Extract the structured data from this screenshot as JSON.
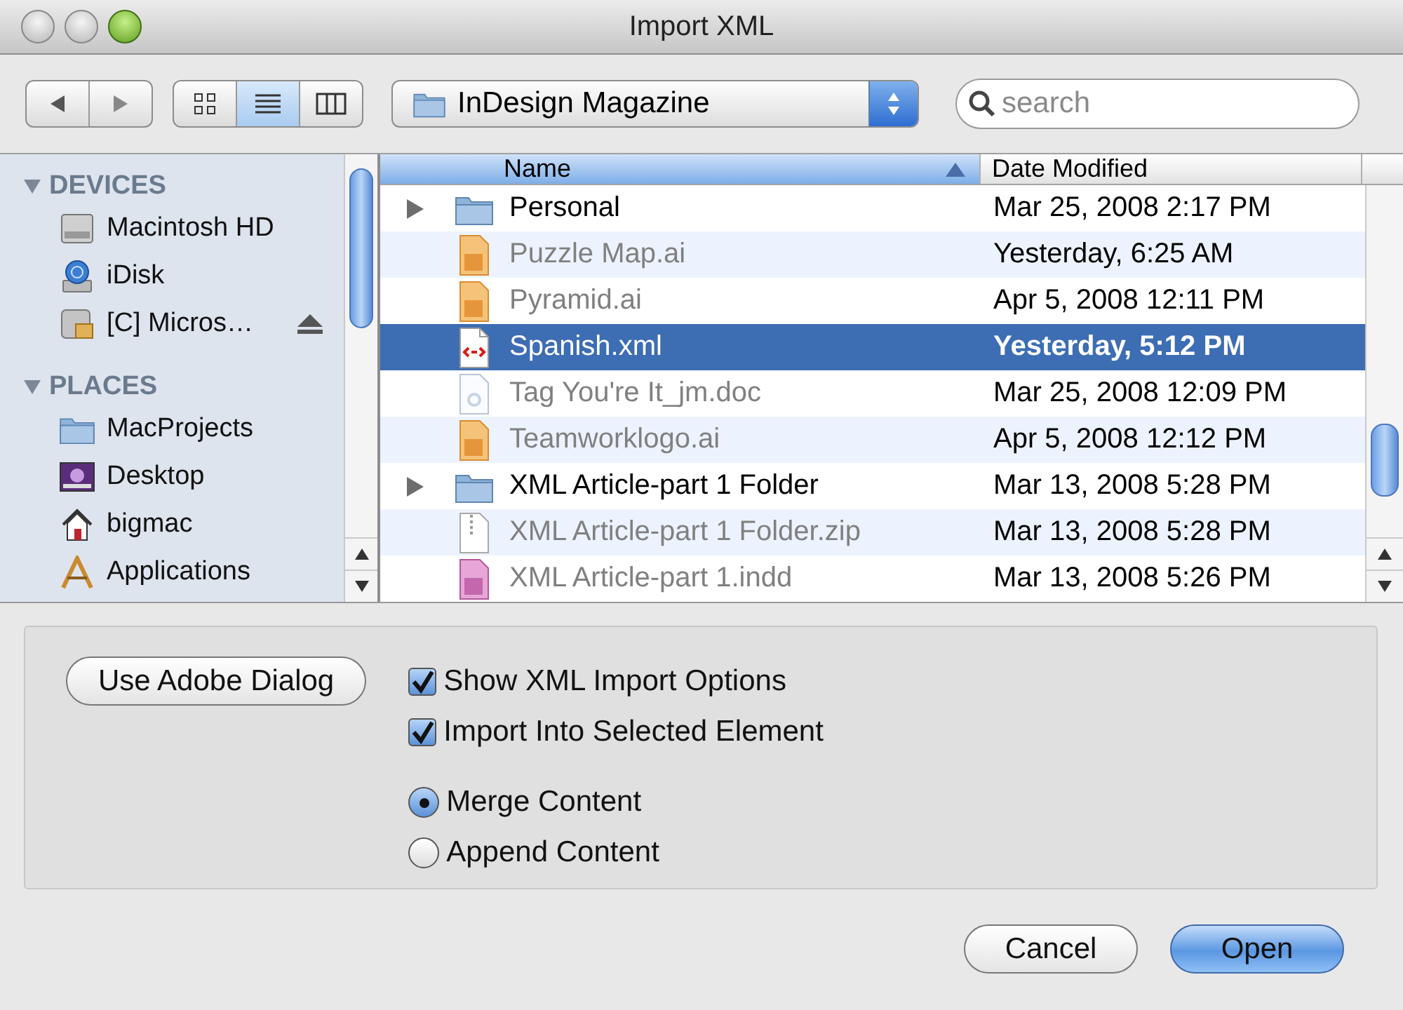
{
  "window": {
    "title": "Import XML"
  },
  "toolbar": {
    "view_modes": [
      {
        "kind": "icon",
        "selected": false
      },
      {
        "kind": "list",
        "selected": true
      },
      {
        "kind": "column",
        "selected": false
      }
    ],
    "location": {
      "value": "InDesign Magazine"
    },
    "search": {
      "placeholder": "search"
    }
  },
  "sidebar": {
    "sections": [
      {
        "title": "DEVICES",
        "expanded": true,
        "items": [
          {
            "label": "Macintosh HD",
            "kind": "drive",
            "ejectable": false
          },
          {
            "label": "iDisk",
            "kind": "idisk",
            "ejectable": false
          },
          {
            "label": "[C] Micros…",
            "kind": "network",
            "ejectable": true
          }
        ]
      },
      {
        "title": "PLACES",
        "expanded": true,
        "items": [
          {
            "label": "MacProjects",
            "kind": "folder",
            "ejectable": false
          },
          {
            "label": "Desktop",
            "kind": "desktop",
            "ejectable": false
          },
          {
            "label": "bigmac",
            "kind": "home",
            "ejectable": false
          },
          {
            "label": "Applications",
            "kind": "apps",
            "ejectable": false
          }
        ]
      }
    ]
  },
  "file_list": {
    "columns": [
      {
        "label": "Name",
        "sorted": true
      },
      {
        "label": "Date Modified",
        "sorted": false
      }
    ],
    "rows": [
      {
        "name": "Personal",
        "date": "Mar 25, 2008 2:17 PM",
        "kind": "folder",
        "disabled": false,
        "selected": false
      },
      {
        "name": "Puzzle Map.ai",
        "date": "Yesterday, 6:25 AM",
        "kind": "ai",
        "disabled": true,
        "selected": false
      },
      {
        "name": "Pyramid.ai",
        "date": "Apr 5, 2008 12:11 PM",
        "kind": "ai",
        "disabled": true,
        "selected": false
      },
      {
        "name": "Spanish.xml",
        "date": "Yesterday, 5:12 PM",
        "kind": "xml",
        "disabled": false,
        "selected": true
      },
      {
        "name": "Tag You're It_jm.doc",
        "date": "Mar 25, 2008 12:09 PM",
        "kind": "doc",
        "disabled": true,
        "selected": false
      },
      {
        "name": "Teamworklogo.ai",
        "date": "Apr 5, 2008 12:12 PM",
        "kind": "ai",
        "disabled": true,
        "selected": false
      },
      {
        "name": "XML Article-part 1 Folder",
        "date": "Mar 13, 2008 5:28 PM",
        "kind": "folder",
        "disabled": false,
        "selected": false
      },
      {
        "name": "XML Article-part 1 Folder.zip",
        "date": "Mar 13, 2008 5:28 PM",
        "kind": "zip",
        "disabled": true,
        "selected": false
      },
      {
        "name": "XML Article-part 1.indd",
        "date": "Mar 13, 2008 5:26 PM",
        "kind": "indd",
        "disabled": true,
        "selected": false
      }
    ]
  },
  "options": {
    "adobe_button": "Use Adobe Dialog",
    "checkboxes": [
      {
        "label": "Show XML Import Options",
        "checked": true
      },
      {
        "label": "Import Into Selected Element",
        "checked": true
      }
    ],
    "radios": [
      {
        "label": "Merge Content",
        "selected": true
      },
      {
        "label": "Append Content",
        "selected": false
      }
    ]
  },
  "buttons": [
    {
      "label": "Cancel",
      "default": false
    },
    {
      "label": "Open",
      "default": true
    }
  ]
}
